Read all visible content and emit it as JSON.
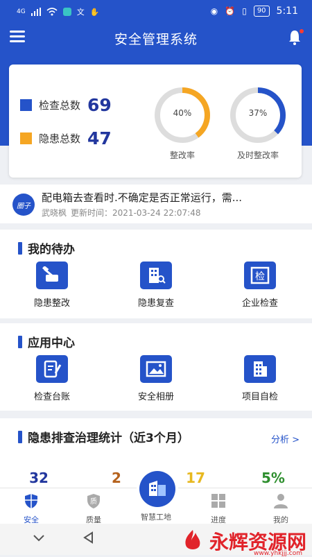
{
  "status_bar": {
    "network": "4G",
    "battery": "90",
    "time": "5:11"
  },
  "header": {
    "title": "安全管理系统"
  },
  "stats": {
    "check_total_label": "检查总数",
    "check_total": "69",
    "hazard_total_label": "隐患总数",
    "hazard_total": "47",
    "rectify_rate_value": 0.4,
    "rectify_rate_text": "40%",
    "rectify_rate_label": "整改率",
    "timely_rate_value": 0.37,
    "timely_rate_text": "37%",
    "timely_rate_label": "及时整改率",
    "colors": {
      "check": "#2553c9",
      "hazard": "#f5a623",
      "ring_bg": "#dddddd"
    }
  },
  "notice": {
    "badge": "圈子",
    "title": "配电箱去查看时.不确定是否正常运行，需...",
    "author": "武晓枫",
    "updated_label": "更新时间：",
    "updated_time": "2021-03-24 22:07:48"
  },
  "todo": {
    "title": "我的待办",
    "items": [
      {
        "label": "隐患整改",
        "icon": "hammer-icon"
      },
      {
        "label": "隐患复查",
        "icon": "building-search-icon"
      },
      {
        "label": "企业检查",
        "icon": "inspect-icon"
      }
    ]
  },
  "apps": {
    "title": "应用中心",
    "items": [
      {
        "label": "检查台账",
        "icon": "ledger-icon"
      },
      {
        "label": "安全相册",
        "icon": "photo-icon"
      },
      {
        "label": "项目自检",
        "icon": "building-icon"
      }
    ]
  },
  "hazard_stats": {
    "title": "隐患排查治理统计（近3个月）",
    "analysis": "分析 >",
    "values": [
      {
        "value": "32",
        "color": "#22379e"
      },
      {
        "value": "2",
        "color": "#b5621d"
      },
      {
        "value": "17",
        "color": "#e7b820"
      },
      {
        "value": "5%",
        "color": "#2f8f2f"
      }
    ]
  },
  "tabbar": {
    "tabs": [
      {
        "label": "安全",
        "icon": "shield-icon"
      },
      {
        "label": "质量",
        "icon": "quality-icon"
      },
      {
        "label": "智慧工地",
        "icon": "smart-site-icon"
      },
      {
        "label": "进度",
        "icon": "grid-icon"
      },
      {
        "label": "我的",
        "icon": "user-icon"
      }
    ]
  },
  "watermark": {
    "text": "永辉资源网",
    "url": "www.yhkjjj.com"
  }
}
